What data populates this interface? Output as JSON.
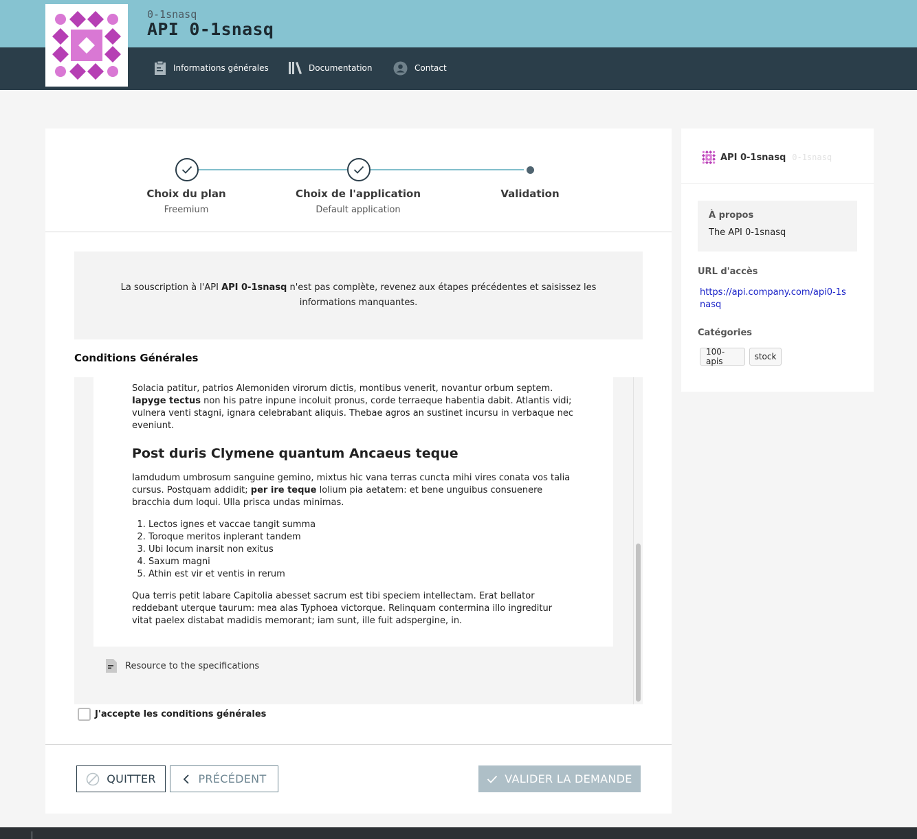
{
  "header": {
    "api_subtitle": "0-1snasq",
    "api_title": "API 0-1snasq",
    "nav": [
      {
        "label": "Informations générales",
        "icon": "clipboard-icon"
      },
      {
        "label": "Documentation",
        "icon": "books-icon"
      },
      {
        "label": "Contact",
        "icon": "user-icon"
      }
    ]
  },
  "stepper": {
    "steps": [
      {
        "title": "Choix du plan",
        "subtitle": "Freemium",
        "state": "done"
      },
      {
        "title": "Choix de l'application",
        "subtitle": "Default application",
        "state": "done"
      },
      {
        "title": "Validation",
        "subtitle": "",
        "state": "current"
      }
    ]
  },
  "notice": {
    "before": "La souscription à l'API ",
    "api_name": "API 0-1snasq",
    "after": " n'est pas complète, revenez aux étapes précédentes et saisissez les informations manquantes."
  },
  "conditions": {
    "title": "Conditions Générales",
    "p1_a": "Solacia patitur, patrios Alemoniden virorum dictis, montibus venerit, novantur orbum septem. ",
    "p1_b": "Iapyge tectus",
    "p1_c": " non his patre inpune incoluit pronus, corde terraeque habentia dabit. Atlantis vidi; vulnera venti stagni, ignara celebrabant aliquis. Thebae agros an sustinet incursu in verbaque nec eveniunt.",
    "heading": "Post duris Clymene quantum Ancaeus teque",
    "p2_a": "Iamdudum umbrosum sanguine gemino, mixtus hic vana terras cuncta mihi vires conata vos talia cursus. Postquam addidit; ",
    "p2_b": "per ire teque",
    "p2_c": " lolium pia aetatem: et bene unguibus consuenere bracchia dum loqui. Ulla prisca undas minimas.",
    "list": [
      "Lectos ignes et vaccae tangit summa",
      "Toroque meritos inplerant tandem",
      "Ubi locum inarsit non exitus",
      "Saxum magni",
      "Athin est vir et ventis in rerum"
    ],
    "p3": "Qua terris petit labare Capitolia abesset sacrum est tibi speciem intellectam. Erat bellator reddebant uterque taurum: mea alas Typhoea victorque. Relinquam contermina illo ingreditur vitat paelex distabat madidis memorant; iam sunt, ille fuit adspergine, in.",
    "resource_label": "Resource to the specifications",
    "accept_label": "J'accepte les conditions générales",
    "accepted": false
  },
  "buttons": {
    "quit": "QUITTER",
    "previous": "PRÉCÉDENT",
    "validate": "VALIDER LA DEMANDE"
  },
  "sidebar": {
    "api_name": "API 0-1snasq",
    "api_version": "0-1snasq",
    "about_label": "À propos",
    "about_value": "The API 0-1snasq",
    "url_label": "URL d'accès",
    "url_value": "https://api.company.com/api0-1snasq",
    "categories_label": "Catégories",
    "categories": [
      "100-apis",
      "stock"
    ]
  },
  "colors": {
    "header_top": "#86c3d1",
    "header_nav": "#2b3e4a",
    "logo_magenta": "#b63fb4",
    "logo_pink": "#d978d4",
    "validate_disabled": "#aebfc7",
    "link": "#1a23c8"
  }
}
